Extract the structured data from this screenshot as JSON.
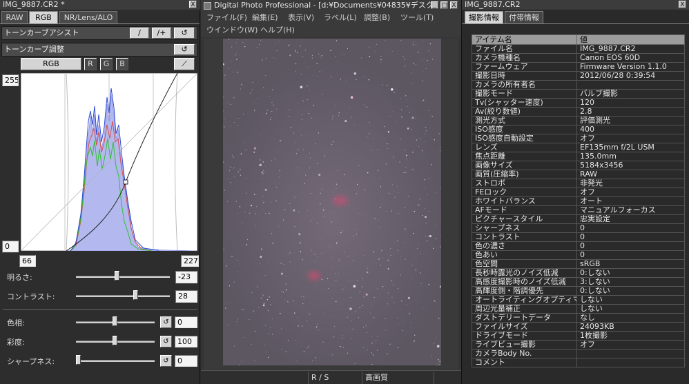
{
  "left_panel": {
    "title": "IMG_9887.CR2 *",
    "close": "X",
    "tabs": [
      "RAW",
      "RGB",
      "NR/Lens/ALO"
    ],
    "active_tab": 1,
    "tone_curve_assist": "トーンカーブアシスト",
    "tone_curve_adjust": "トーンカーブ調整",
    "channels": [
      "RGB",
      "R",
      "G",
      "B"
    ],
    "axis_top": "255",
    "axis_bottom": "0",
    "input_low": "66",
    "input_high": "227",
    "brightness_label": "明るさ:",
    "brightness_value": "-23",
    "brightness_level": 0.44,
    "contrast_label": "コントラスト:",
    "contrast_value": "28",
    "contrast_level": 0.64,
    "hue_label": "色相:",
    "hue_value": "0",
    "hue_level": 0.5,
    "saturation_label": "彩度:",
    "saturation_value": "100",
    "saturation_level": 0.5,
    "sharpness_label": "シャープネス:",
    "sharpness_value": "0",
    "sharpness_level": 0.0,
    "reset_icon": "reset-icon",
    "eyedropper_icon": "eyedropper-icon",
    "colors": {
      "panel_bg": "#2d2d2d",
      "histogram_fill": "#aeb4f0",
      "green_line": "#35c035",
      "red_line": "#d04848",
      "blue_line": "#2848d0"
    }
  },
  "viewer": {
    "title": "Digital Photo Professional - [d:¥Documents¥04835¥デスク",
    "title_buttons": [
      "_",
      "□",
      "X"
    ],
    "menu_row1": [
      "ファイル(F)",
      "編集(E)",
      "表示(V)",
      "ラベル(L)",
      "調整(B)",
      "ツール(T)"
    ],
    "menu_row2": [
      "ウインドウ(W)",
      "ヘルプ(H)"
    ],
    "status": [
      "R / S",
      "高画質"
    ]
  },
  "right_panel": {
    "title": "IMG_9887.CR2",
    "close": "X",
    "tabs": [
      "撮影情報",
      "付帯情報"
    ],
    "header_item": "アイテム名",
    "header_value": "値",
    "rows": [
      [
        "ファイル名",
        "IMG_9887.CR2"
      ],
      [
        "カメラ機種名",
        "Canon EOS 60D"
      ],
      [
        "ファームウェア",
        "Firmware Version 1.1.0"
      ],
      [
        "撮影日時",
        "2012/06/28 0:39:54"
      ],
      [
        "カメラの所有者名",
        ""
      ],
      [
        "撮影モード",
        "バルブ撮影"
      ],
      [
        "Tv(シャッター速度)",
        "120"
      ],
      [
        "Av(絞り数値)",
        "2.8"
      ],
      [
        "測光方式",
        "評価測光"
      ],
      [
        "ISO感度",
        "400"
      ],
      [
        "ISO感度自動設定",
        "オフ"
      ],
      [
        "レンズ",
        "EF135mm f/2L USM"
      ],
      [
        "焦点距離",
        "135.0mm"
      ],
      [
        "画像サイズ",
        "5184x3456"
      ],
      [
        "画質(圧縮率)",
        "RAW"
      ],
      [
        "ストロボ",
        "非発光"
      ],
      [
        "FEロック",
        "オフ"
      ],
      [
        "ホワイトバランス",
        "オート"
      ],
      [
        "AFモード",
        "マニュアルフォーカス"
      ],
      [
        "ピクチャースタイル",
        "忠実設定"
      ],
      [
        "シャープネス",
        "0"
      ],
      [
        "コントラスト",
        "0"
      ],
      [
        "色の濃さ",
        "0"
      ],
      [
        "色あい",
        "0"
      ],
      [
        "色空間",
        "sRGB"
      ],
      [
        "長秒時露光のノイズ低減",
        "0:しない"
      ],
      [
        "高感度撮影時のノイズ低減",
        "3:しない"
      ],
      [
        "高輝度側・階調優先",
        "0:しない"
      ],
      [
        "オートライティングオプティマイザ",
        "しない"
      ],
      [
        "周辺光量補正",
        "しない"
      ],
      [
        "ダストデリートデータ",
        "なし"
      ],
      [
        "ファイルサイズ",
        "24093KB"
      ],
      [
        "ドライブモード",
        "1枚撮影"
      ],
      [
        "ライブビュー撮影",
        "オフ"
      ],
      [
        "カメラBody No.",
        ""
      ],
      [
        "コメント",
        ""
      ]
    ]
  }
}
